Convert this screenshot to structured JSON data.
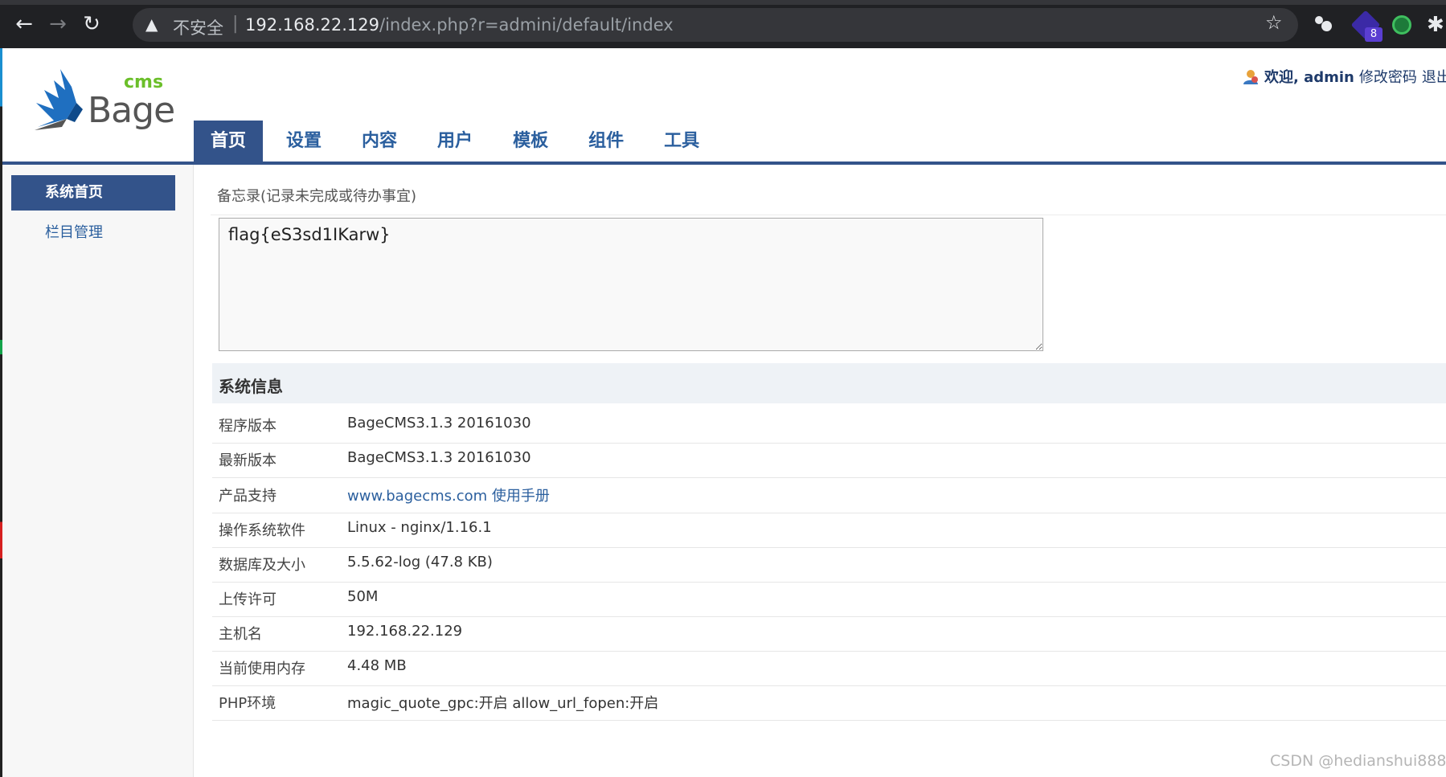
{
  "browser": {
    "security_label": "不安全",
    "url_host": "192.168.22.129",
    "url_path": "/index.php?r=admini/default/index",
    "extension_badge": "8"
  },
  "header": {
    "logo_small": "cms",
    "logo_main": "Bage",
    "welcome": "欢迎, admin",
    "change_password": "修改密码",
    "logout": "退出登"
  },
  "main_nav": {
    "tabs": [
      {
        "label": "首页"
      },
      {
        "label": "设置"
      },
      {
        "label": "内容"
      },
      {
        "label": "用户"
      },
      {
        "label": "模板"
      },
      {
        "label": "组件"
      },
      {
        "label": "工具"
      }
    ]
  },
  "sidebar": {
    "items": [
      {
        "label": "系统首页"
      },
      {
        "label": "栏目管理"
      }
    ]
  },
  "memo": {
    "label": "备忘录(记录未完成或待办事宜)",
    "value": "flag{eS3sd1IKarw}"
  },
  "system_info": {
    "title": "系统信息",
    "rows": [
      {
        "key": "程序版本",
        "value": "BageCMS3.1.3 20161030"
      },
      {
        "key": "最新版本",
        "value": "BageCMS3.1.3 20161030"
      },
      {
        "key": "产品支持",
        "value": "www.bagecms.com",
        "value_extra": "使用手册"
      },
      {
        "key": "操作系统软件",
        "value": "Linux - nginx/1.16.1"
      },
      {
        "key": "数据库及大小",
        "value": "5.5.62-log (47.8 KB)"
      },
      {
        "key": "上传许可",
        "value": "50M"
      },
      {
        "key": "主机名",
        "value": "192.168.22.129"
      },
      {
        "key": "当前使用内存",
        "value": "4.48 MB"
      },
      {
        "key": "PHP环境",
        "value": "magic_quote_gpc:开启 allow_url_fopen:开启"
      }
    ]
  },
  "watermark": "CSDN @hedianshui888"
}
